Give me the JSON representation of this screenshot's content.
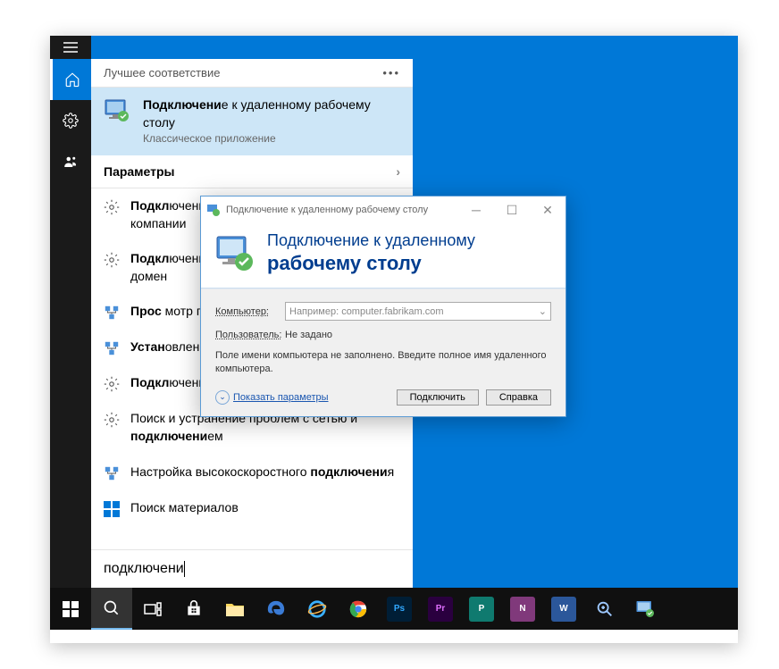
{
  "search": {
    "best_match_header": "Лучшее соответствие",
    "best_match_title_pre": "Подключени",
    "best_match_title_rest": "е к удаленному рабочему столу",
    "best_match_sub": "Классическое приложение",
    "params_header": "Параметры",
    "results": [
      {
        "text": "Подключение к рабочему месту, или компании",
        "bold": "Подкл"
      },
      {
        "text": "Подключение удаленного доступа, добавить домен",
        "bold": "Подкл"
      },
      {
        "text": "Прос  мотр подключений",
        "bold": "Прос"
      },
      {
        "text": "Установление подключения",
        "bold": "Устан"
      },
      {
        "text": "Подключение к удаленному рабочему столу",
        "bold": "Подкл"
      },
      {
        "text": "Поиск и устранение проблем с сетью и подключением",
        "bold_inner": "подключени"
      },
      {
        "text": "Настройка высокоскоростного подключения",
        "bold_inner": "подключени"
      }
    ],
    "store_result": "Поиск материалов",
    "input_value": "подключени"
  },
  "rdp": {
    "title": "Подключение к удаленному рабочему столу",
    "banner_line1": "Подключение к удаленному",
    "banner_line2": "рабочему столу",
    "label_computer": "Компьютер:",
    "placeholder_computer": "Например: computer.fabrikam.com",
    "label_user": "Пользователь:",
    "value_user": "Не задано",
    "info": "Поле имени компьютера не заполнено. Введите полное имя удаленного компьютера.",
    "show_options": "Показать параметры",
    "btn_connect": "Подключить",
    "btn_help": "Справка"
  },
  "taskbar": {
    "apps": [
      {
        "name": "start",
        "color": "#fff"
      },
      {
        "name": "search",
        "color": "#fff"
      },
      {
        "name": "taskview",
        "color": "#fff"
      },
      {
        "name": "store",
        "color": "#fff",
        "badge_bg": "#fff"
      },
      {
        "name": "explorer",
        "color": "#ffcf48"
      },
      {
        "name": "edge",
        "color": "#3a7bd5"
      },
      {
        "name": "ie",
        "color": "#3ab0ff"
      },
      {
        "name": "chrome",
        "color": "#fff"
      },
      {
        "name": "photoshop",
        "label": "Ps",
        "bg": "#001e36",
        "fg": "#31a8ff"
      },
      {
        "name": "premiere",
        "label": "Pr",
        "bg": "#2a003f",
        "fg": "#e070ff"
      },
      {
        "name": "publisher",
        "label": "P",
        "bg": "#0f7a6f",
        "fg": "#fff"
      },
      {
        "name": "onenote",
        "label": "N",
        "bg": "#80397b",
        "fg": "#fff"
      },
      {
        "name": "word",
        "label": "W",
        "bg": "#2b579a",
        "fg": "#fff"
      },
      {
        "name": "magnifier",
        "color": "#fff"
      },
      {
        "name": "rdp-app",
        "color": "#fff"
      }
    ]
  }
}
